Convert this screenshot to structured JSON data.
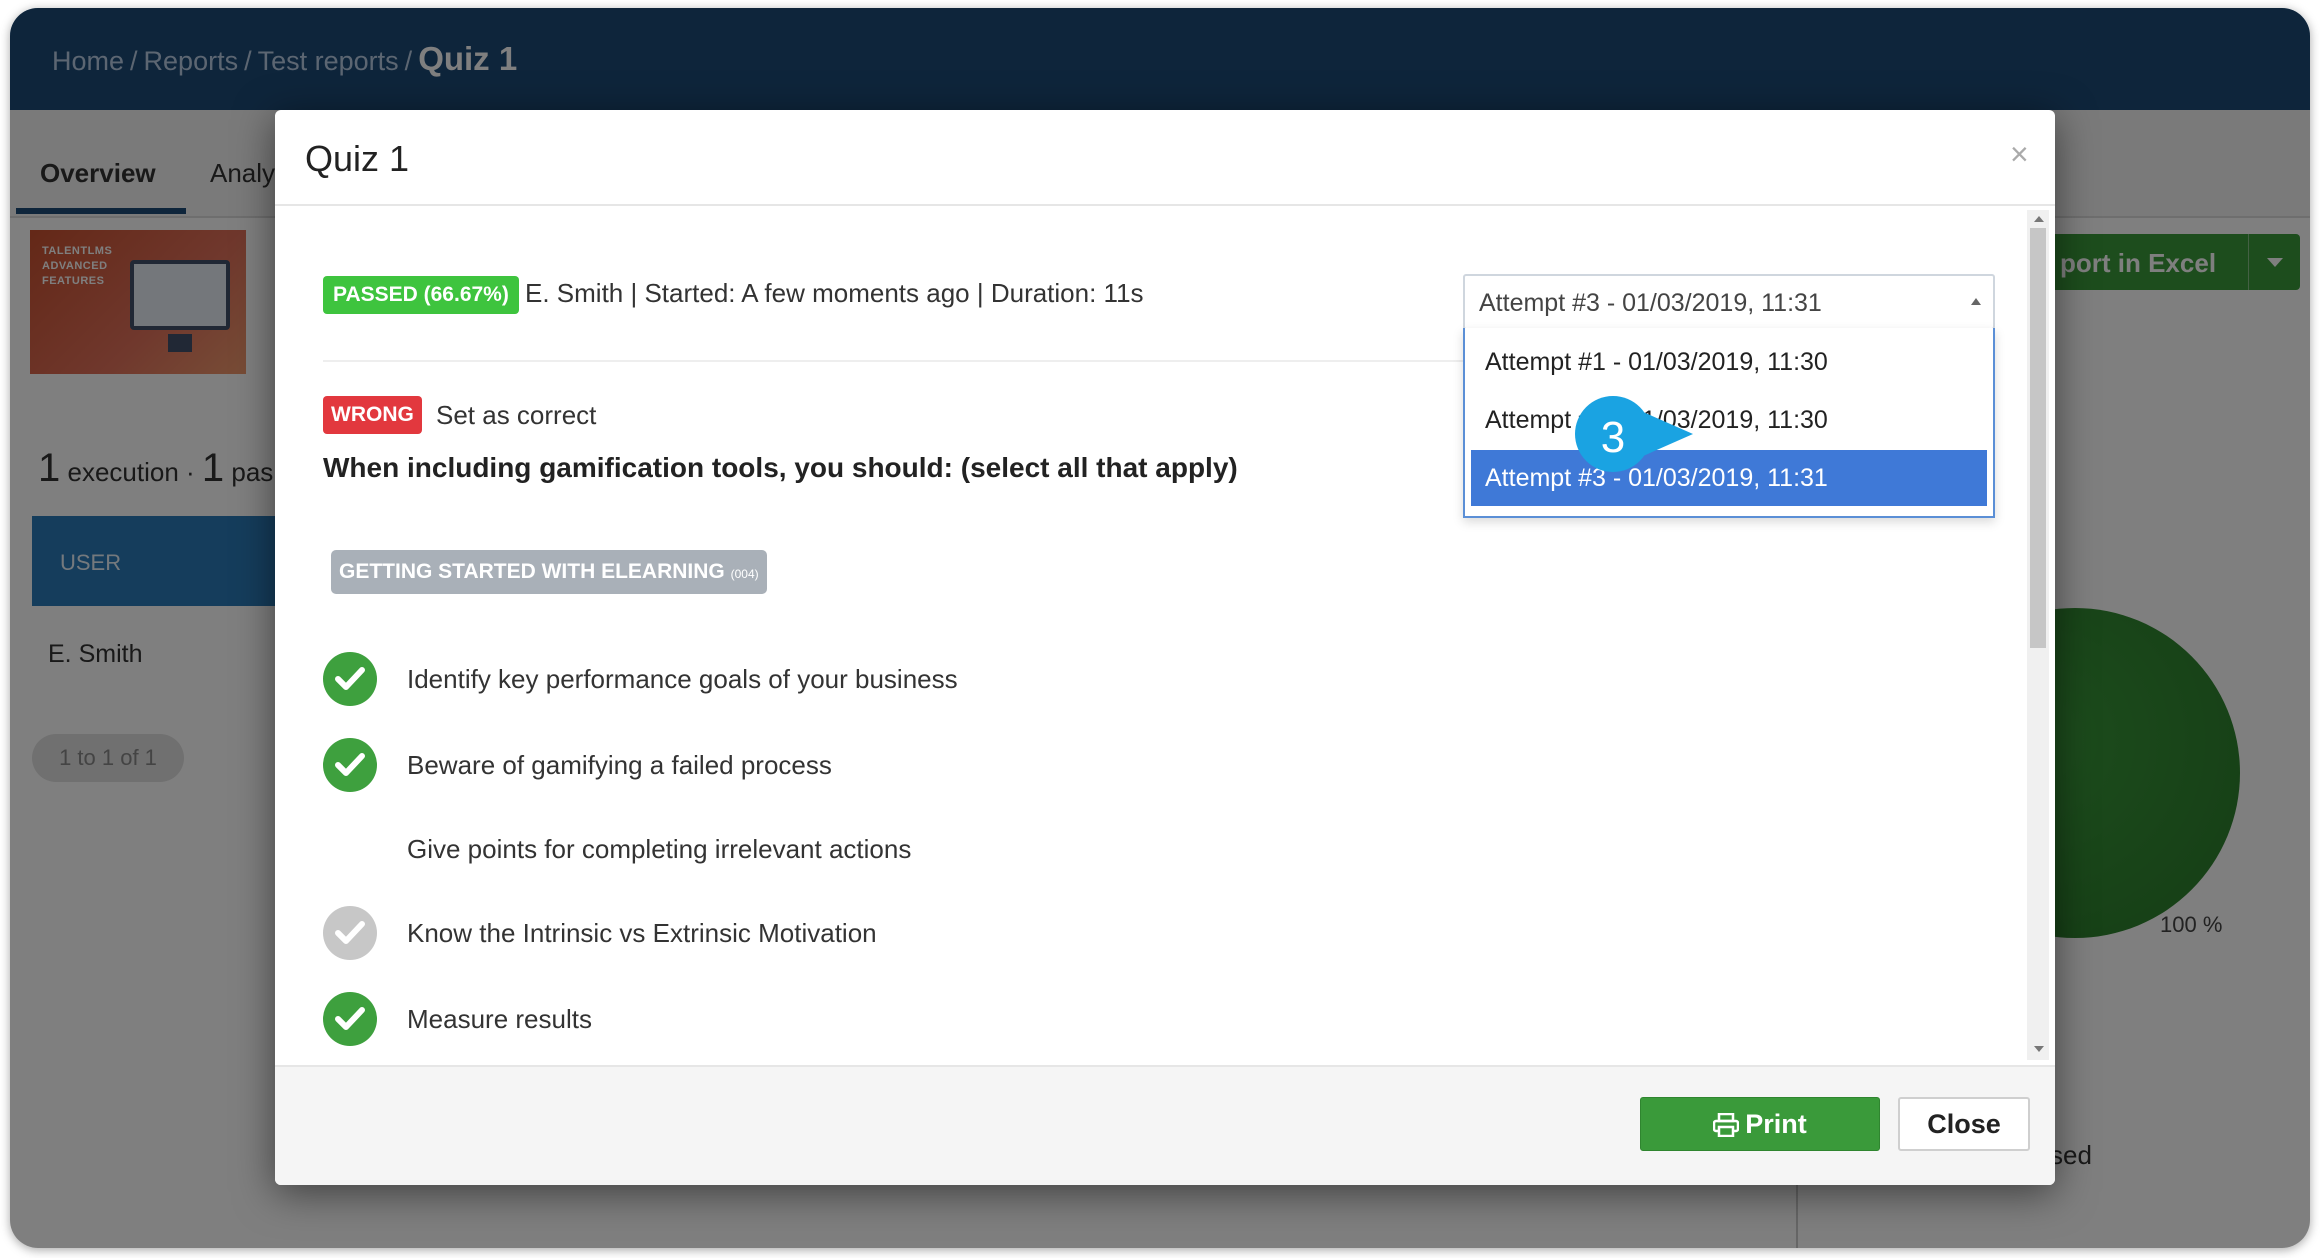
{
  "breadcrumb": {
    "items": [
      "Home",
      "Reports",
      "Test reports"
    ],
    "separator": "/",
    "current": "Quiz 1"
  },
  "tabs": {
    "overview": "Overview",
    "analysis": "Analy"
  },
  "course_thumb": {
    "line1": "TALENTLMS",
    "line2": "ADVANCED",
    "line3": "FEATURES"
  },
  "summary": {
    "exec_count": "1",
    "exec_label": "execution ·",
    "pass_count": "1",
    "pass_label": "pas"
  },
  "user_table": {
    "header": "USER",
    "row_user": "E. Smith"
  },
  "pager": "1 to 1 of 1",
  "export_button": "port in Excel",
  "pie": {
    "label": "100 %",
    "legend_fragment": "sed"
  },
  "modal": {
    "title": "Quiz 1",
    "close_glyph": "×",
    "passed_badge": "PASSED (66.67%)",
    "meta": "E. Smith | Started: A few moments ago | Duration: 11s",
    "wrong_badge": "WRONG",
    "set_correct": "Set as correct",
    "question": "When including gamification tools, you should: (select all that apply)",
    "topic_tag": "GETTING STARTED WITH ELEARNING",
    "topic_code": "(004)",
    "answers": [
      {
        "text": "Identify key performance goals of your business",
        "icon": "check-green"
      },
      {
        "text": "Beware of gamifying a failed process",
        "icon": "check-green"
      },
      {
        "text": "Give points for completing irrelevant actions",
        "icon": "none"
      },
      {
        "text": "Know the Intrinsic vs Extrinsic Motivation",
        "icon": "check-grey"
      },
      {
        "text": "Measure results",
        "icon": "check-green"
      }
    ],
    "attempt_select": {
      "value": "Attempt #3 - 01/03/2019, 11:31",
      "options": [
        "Attempt #1 - 01/03/2019, 11:30",
        "Attempt #2 - 01/03/2019, 11:30",
        "Attempt #3 - 01/03/2019, 11:31"
      ],
      "selected_index": 2
    },
    "step_marker": "3",
    "print_button": "Print",
    "close_button": "Close"
  },
  "colors": {
    "topbar": "#1c4a76",
    "passed": "#3ec43e",
    "wrong": "#e2383e",
    "check": "#3ea03e",
    "selected_option": "#3f79d7",
    "step_marker": "#1aa3e2"
  }
}
